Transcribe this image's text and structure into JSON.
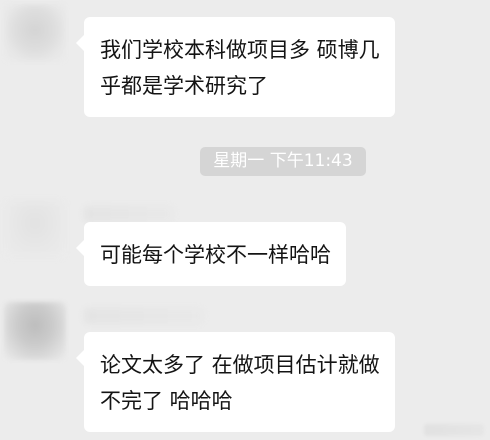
{
  "conversation": {
    "messages": [
      {
        "lines": [
          "我们学校本科做项目多 硕博几",
          "乎都是学术研究了"
        ]
      },
      {
        "lines": [
          "可能每个学校不一样哈哈"
        ]
      },
      {
        "lines": [
          "论文太多了 在做项目估计就做",
          "不完了 哈哈哈"
        ]
      }
    ],
    "timestamp": "星期一 下午11:43"
  },
  "colors": {
    "background": "#ececec",
    "bubble": "#ffffff",
    "text": "#141414",
    "timestamp_bg": "#d5d5d5",
    "timestamp_text": "#ffffff"
  }
}
